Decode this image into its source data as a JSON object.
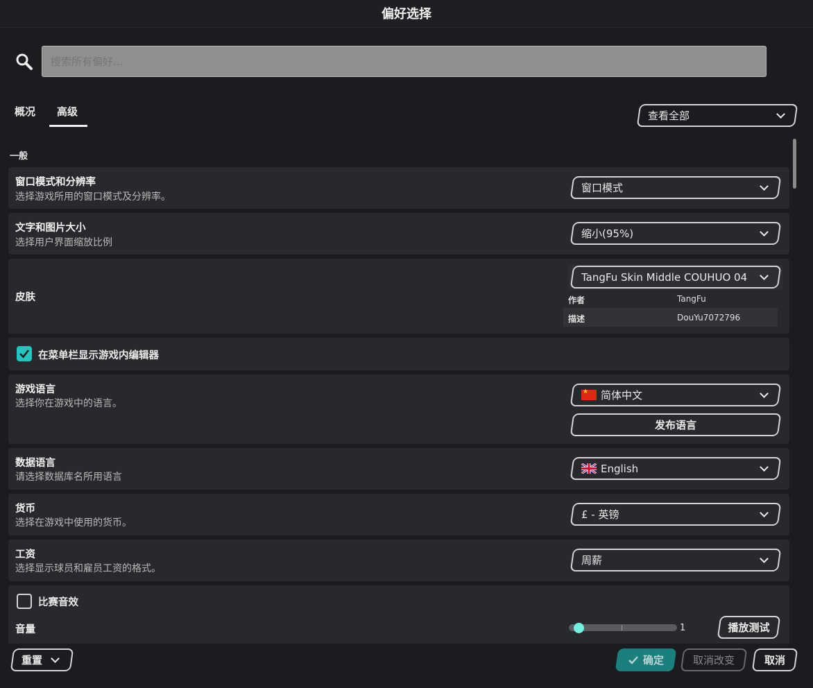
{
  "window": {
    "title": "偏好选择"
  },
  "search": {
    "placeholder": "搜索所有偏好..."
  },
  "tabs": [
    {
      "label": "概况"
    },
    {
      "label": "高级"
    }
  ],
  "view_filter": {
    "value": "查看全部"
  },
  "section": {
    "label": "一般"
  },
  "rows": {
    "window_mode": {
      "title": "窗口模式和分辨率",
      "desc": "选择游戏所用的窗口模式及分辨率。",
      "value": "窗口模式"
    },
    "text_size": {
      "title": "文字和图片大小",
      "desc": "选择用户界面缩放比例",
      "value": "缩小(95%)"
    },
    "skin": {
      "title": "皮肤",
      "value": "TangFu Skin Middle COUHUO 04",
      "author_label": "作者",
      "author_value": "TangFu",
      "desc_label": "描述",
      "desc_value": "DouYu7072796"
    },
    "show_editor": {
      "label": "在菜单栏显示游戏内编辑器",
      "checked": true
    },
    "game_language": {
      "title": "游戏语言",
      "desc": "选择你在游戏中的语言。",
      "value": "简体中文",
      "publish_label": "发布语言"
    },
    "data_language": {
      "title": "数据语言",
      "desc": "请选择数据库名所用语言",
      "value": "English"
    },
    "currency": {
      "title": "货币",
      "desc": "选择在游戏中使用的货币。",
      "value": "£ - 英镑"
    },
    "wages": {
      "title": "工资",
      "desc": "选择显示球员和雇员工资的格式。",
      "value": "周薪"
    },
    "match_sound": {
      "label": "比赛音效",
      "checked": false
    },
    "volume": {
      "label": "音量",
      "value": "1",
      "play_test_label": "播放测试"
    }
  },
  "footer": {
    "reset_label": "重置",
    "confirm_label": "确定",
    "revert_label": "取消改变",
    "cancel_label": "取消"
  },
  "colors": {
    "accent": "#23c5c0",
    "row_bg": "#28292c",
    "page_bg": "#1b1c1f"
  }
}
